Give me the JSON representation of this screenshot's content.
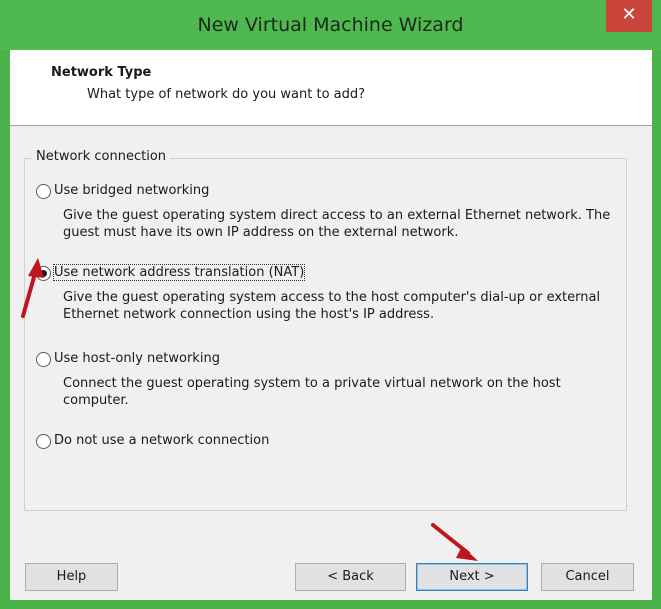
{
  "window": {
    "title": "New Virtual Machine Wizard",
    "close_glyph": "✕"
  },
  "header": {
    "title": "Network Type",
    "subtitle": "What type of network do you want to add?"
  },
  "group": {
    "label": "Network connection"
  },
  "options": [
    {
      "label": "Use bridged networking",
      "selected": false,
      "description": "Give the guest operating system direct access to an external Ethernet network. The guest must have its own IP address on the external network."
    },
    {
      "label": "Use network address translation (NAT)",
      "selected": true,
      "description": "Give the guest operating system access to the host computer's dial-up or external Ethernet network connection using the host's IP address."
    },
    {
      "label": "Use host-only networking",
      "selected": false,
      "description": "Connect the guest operating system to a private virtual network on the host computer."
    },
    {
      "label": "Do not use a network connection",
      "selected": false,
      "description": ""
    }
  ],
  "buttons": {
    "help": "Help",
    "back": "< Back",
    "next": "Next >",
    "cancel": "Cancel"
  },
  "colors": {
    "titlebar": "#4fb84f",
    "close": "#c9453a",
    "annotation_arrow": "#c0151c"
  }
}
